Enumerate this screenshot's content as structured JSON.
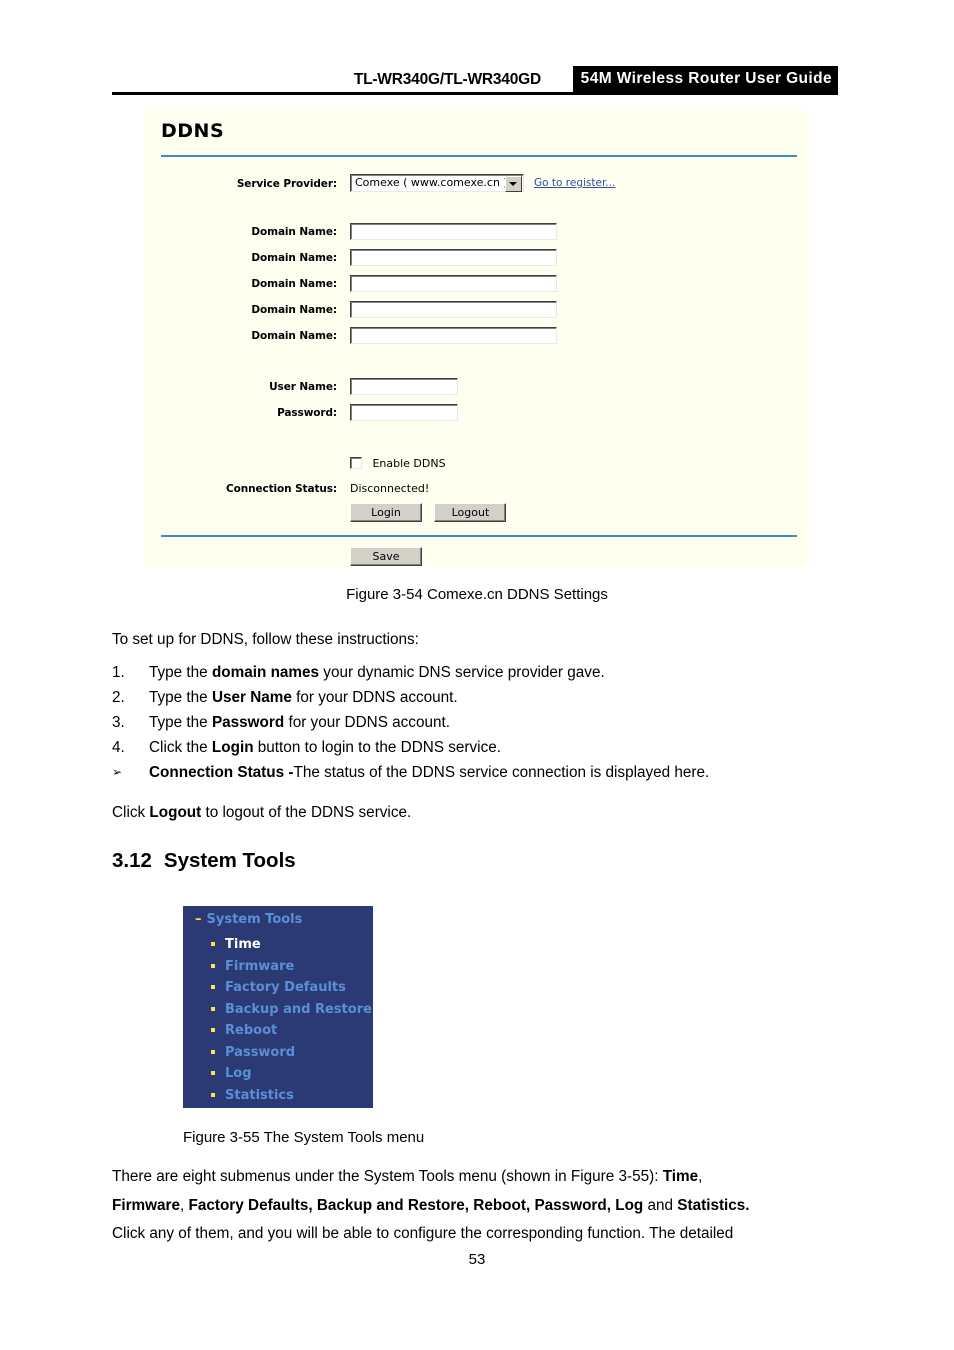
{
  "header": {
    "title_left": "TL-WR340G/TL-WR340GD",
    "title_right": "54M  Wireless  Router  User  Guide"
  },
  "ddns_panel": {
    "title": "DDNS",
    "service_provider_label": "Service Provider:",
    "service_provider_value": "Comexe ( www.comexe.cn )",
    "go_to_register_link": "Go to register...",
    "domain_name_label": "Domain Name:",
    "domain_names": [
      "",
      "",
      "",
      "",
      ""
    ],
    "user_name_label": "User Name:",
    "user_name_value": "",
    "password_label": "Password:",
    "password_value": "",
    "enable_ddns_label": "Enable DDNS",
    "enable_ddns_checked": false,
    "connection_status_label": "Connection Status:",
    "connection_status_value": "Disconnected!",
    "login_button": "Login",
    "logout_button": "Logout",
    "save_button": "Save",
    "colors": {
      "panel_background": "#fffff0",
      "divider_blue": "#3b8dc0",
      "link_blue": "#2b4ea2",
      "button_face": "#d4d0c8"
    }
  },
  "fig_54_caption": "Figure 3-54 Comexe.cn DDNS Settings",
  "intro_line": "To set up for DDNS, follow these instructions:",
  "steps": [
    {
      "marker": "1.",
      "pre": "Type the ",
      "bold": "domain names",
      "post": " your dynamic DNS service provider gave."
    },
    {
      "marker": "2.",
      "pre": "Type the ",
      "bold": "User Name",
      "post": " for your DDNS account."
    },
    {
      "marker": "3.",
      "pre": "Type the ",
      "bold": "Password",
      "post": " for your DDNS account."
    },
    {
      "marker": "4.",
      "pre": "Click the ",
      "bold": "Login",
      "post": " button to login to the DDNS service."
    },
    {
      "marker": "➢",
      "pre": "",
      "bold": "Connection Status -",
      "post": "The status of the DDNS service connection is displayed here."
    }
  ],
  "logout_line": {
    "pre": "Click ",
    "bold": "Logout",
    "post": " to logout of the DDNS service."
  },
  "section": {
    "number": "3.12",
    "title": "System Tools"
  },
  "system_tools_menu": {
    "root_label": "System Tools",
    "root_expand_glyph": "–",
    "items": [
      {
        "label": "Time",
        "selected": true
      },
      {
        "label": "Firmware",
        "selected": false
      },
      {
        "label": "Factory Defaults",
        "selected": false
      },
      {
        "label": "Backup and Restore",
        "selected": false
      },
      {
        "label": "Reboot",
        "selected": false
      },
      {
        "label": "Password",
        "selected": false
      },
      {
        "label": "Log",
        "selected": false
      },
      {
        "label": "Statistics",
        "selected": false
      }
    ],
    "colors": {
      "background": "#2b3a74",
      "link": "#5b8fd4",
      "selected": "#ffffff",
      "bullet": "#ffe14d"
    }
  },
  "fig_55_caption": "Figure 3-55 The System Tools menu",
  "closing_paragraph": {
    "line1_pre": "There   are   eight   submenus   under   the   System   Tools   menu   (shown   in   Figure   3-55):",
    "line1_bold": "Time",
    "line1_post": ",",
    "line2": [
      {
        "text": "Firmware",
        "bold": true
      },
      {
        "text": ", ",
        "bold": false
      },
      {
        "text": "Factory Defaults, Backup and Restore, Reboot, Password, Log",
        "bold": true
      },
      {
        "text": " and ",
        "bold": false
      },
      {
        "text": "Statistics.",
        "bold": true
      }
    ],
    "line3": "Click  any  of  them,  and  you  will  be  able  to  configure  the  corresponding  function.  The  detailed"
  },
  "page_number": "53"
}
